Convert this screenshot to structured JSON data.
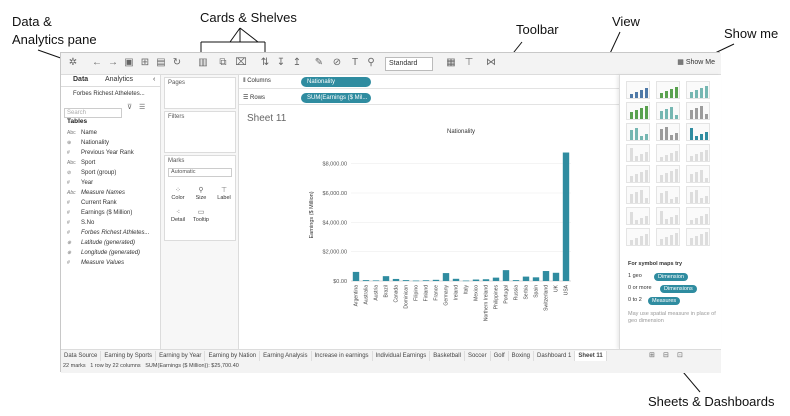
{
  "callouts": {
    "data_analytics": "Data &\nAnalytics pane",
    "cards_shelves": "Cards & Shelves",
    "toolbar": "Toolbar",
    "view": "View",
    "show_me": "Show me",
    "sheets_dashboards": "Sheets & Dashboards"
  },
  "toolbar": {
    "standard": "Standard",
    "show_me_label": "Show Me"
  },
  "left_pane": {
    "tab_data": "Data",
    "tab_analytics": "Analytics",
    "datasource": "Forbes Richest Atheletes...",
    "search_placeholder": "Search",
    "tables_heading": "Tables",
    "fields": [
      {
        "type": "Abc",
        "name": "Name",
        "italic": false
      },
      {
        "type": "⊕",
        "name": "Nationality",
        "italic": false
      },
      {
        "type": "#",
        "name": "Previous Year Rank",
        "italic": false
      },
      {
        "type": "Abc",
        "name": "Sport",
        "italic": false
      },
      {
        "type": "⊘",
        "name": "Sport (group)",
        "italic": false
      },
      {
        "type": "#",
        "name": "Year",
        "italic": false
      },
      {
        "type": "Abc",
        "name": "Measure Names",
        "italic": true
      },
      {
        "type": "#",
        "name": "Current Rank",
        "italic": false
      },
      {
        "type": "#",
        "name": "Earnings ($ Million)",
        "italic": false
      },
      {
        "type": "#",
        "name": "S.No",
        "italic": false
      },
      {
        "type": "#",
        "name": "Forbes Richest Athletes...",
        "italic": true
      },
      {
        "type": "⊕",
        "name": "Latitude (generated)",
        "italic": true
      },
      {
        "type": "⊕",
        "name": "Longitude (generated)",
        "italic": true
      },
      {
        "type": "#",
        "name": "Measure Values",
        "italic": true
      }
    ]
  },
  "cards": {
    "pages": "Pages",
    "filters": "Filters",
    "marks": "Marks",
    "marks_type": "Automatic",
    "color": "Color",
    "size": "Size",
    "label": "Label",
    "detail": "Detail",
    "tooltip": "Tooltip"
  },
  "shelves": {
    "columns_label": "Columns",
    "columns_pill": "Nationality",
    "rows_label": "Rows",
    "rows_pill": "SUM(Earnings ($ Mil..."
  },
  "view": {
    "sheet_title": "Sheet 11"
  },
  "chart_data": {
    "type": "bar",
    "title": "Nationality",
    "ylabel": "Earnings ($ Million)",
    "xlabel": "",
    "ylim": [
      0,
      9000
    ],
    "yticks": [
      "$0.00",
      "$2,000.00",
      "$4,000.00",
      "$6,000.00",
      "$8,000.00"
    ],
    "ytick_values": [
      0,
      2000,
      4000,
      6000,
      8000
    ],
    "categories": [
      "Argentina",
      "Australia",
      "Austria",
      "Brazil",
      "Canada",
      "Dominican",
      "Filipino",
      "Finland",
      "France",
      "Germany",
      "Ireland",
      "Italy",
      "Mexico",
      "Northern Ireland",
      "Philippines",
      "Portugal",
      "Russia",
      "Serbia",
      "Spain",
      "Switzerland",
      "UK",
      "USA"
    ],
    "values": [
      620,
      60,
      40,
      330,
      140,
      60,
      30,
      50,
      80,
      540,
      150,
      30,
      100,
      120,
      230,
      740,
      60,
      300,
      250,
      680,
      560,
      8760
    ],
    "color": "#2f8ca0"
  },
  "show_me": {
    "hint_title": "For symbol maps try",
    "row1_prefix": "1 geo",
    "row1_pill": "Dimension",
    "row2_prefix": "0 or more",
    "row2_pill": "Dimensions",
    "row3_prefix": "0 to 2",
    "row3_pill": "Measures",
    "footnote": "May use spatial measure in place of geo dimension"
  },
  "bottom": {
    "tabs": [
      "Data Source",
      "Earning by Sports",
      "Earning by Year",
      "Earning by Nation",
      "Earning Analysis",
      "Increase in earnings",
      "Individual Earnings",
      "Basketball",
      "Soccer",
      "Golf",
      "Boxing",
      "Dashboard 1",
      "Sheet 11"
    ],
    "active_tab": "Sheet 11",
    "status_marks": "22 marks",
    "status_rows": "1 row by 22 columns",
    "status_sum": "SUM(Earnings ($ Million)): $25,700.40"
  }
}
